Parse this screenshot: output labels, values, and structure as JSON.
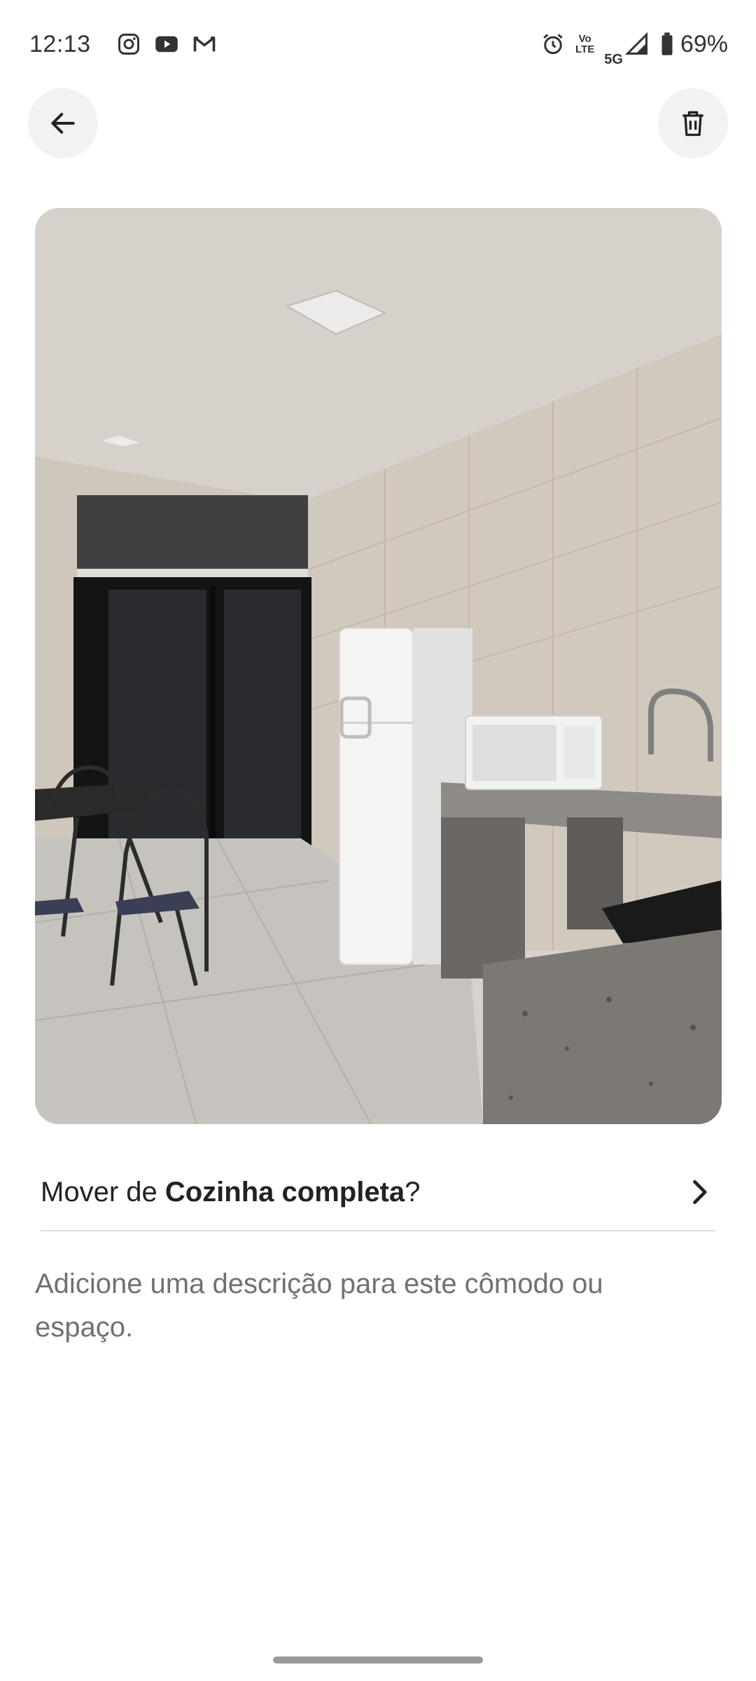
{
  "status_bar": {
    "time": "12:13",
    "notification_icons": [
      "instagram-icon",
      "youtube-icon",
      "gmail-icon"
    ],
    "volte_line1": "Vo",
    "volte_line2": "LTE",
    "network": "5G",
    "battery": "69%"
  },
  "header": {
    "back_icon": "arrow-left-icon",
    "delete_icon": "trash-icon"
  },
  "photo": {
    "subject": "kitchen-photo"
  },
  "move_row": {
    "prefix": "Mover de ",
    "room": "Cozinha completa",
    "suffix": "?"
  },
  "description": {
    "placeholder": "Adicione uma descrição para este cômodo ou espaço."
  },
  "colors": {
    "text_primary": "#222222",
    "text_secondary": "#717171",
    "button_bg": "#f2f2f2",
    "divider": "#dddddd"
  }
}
